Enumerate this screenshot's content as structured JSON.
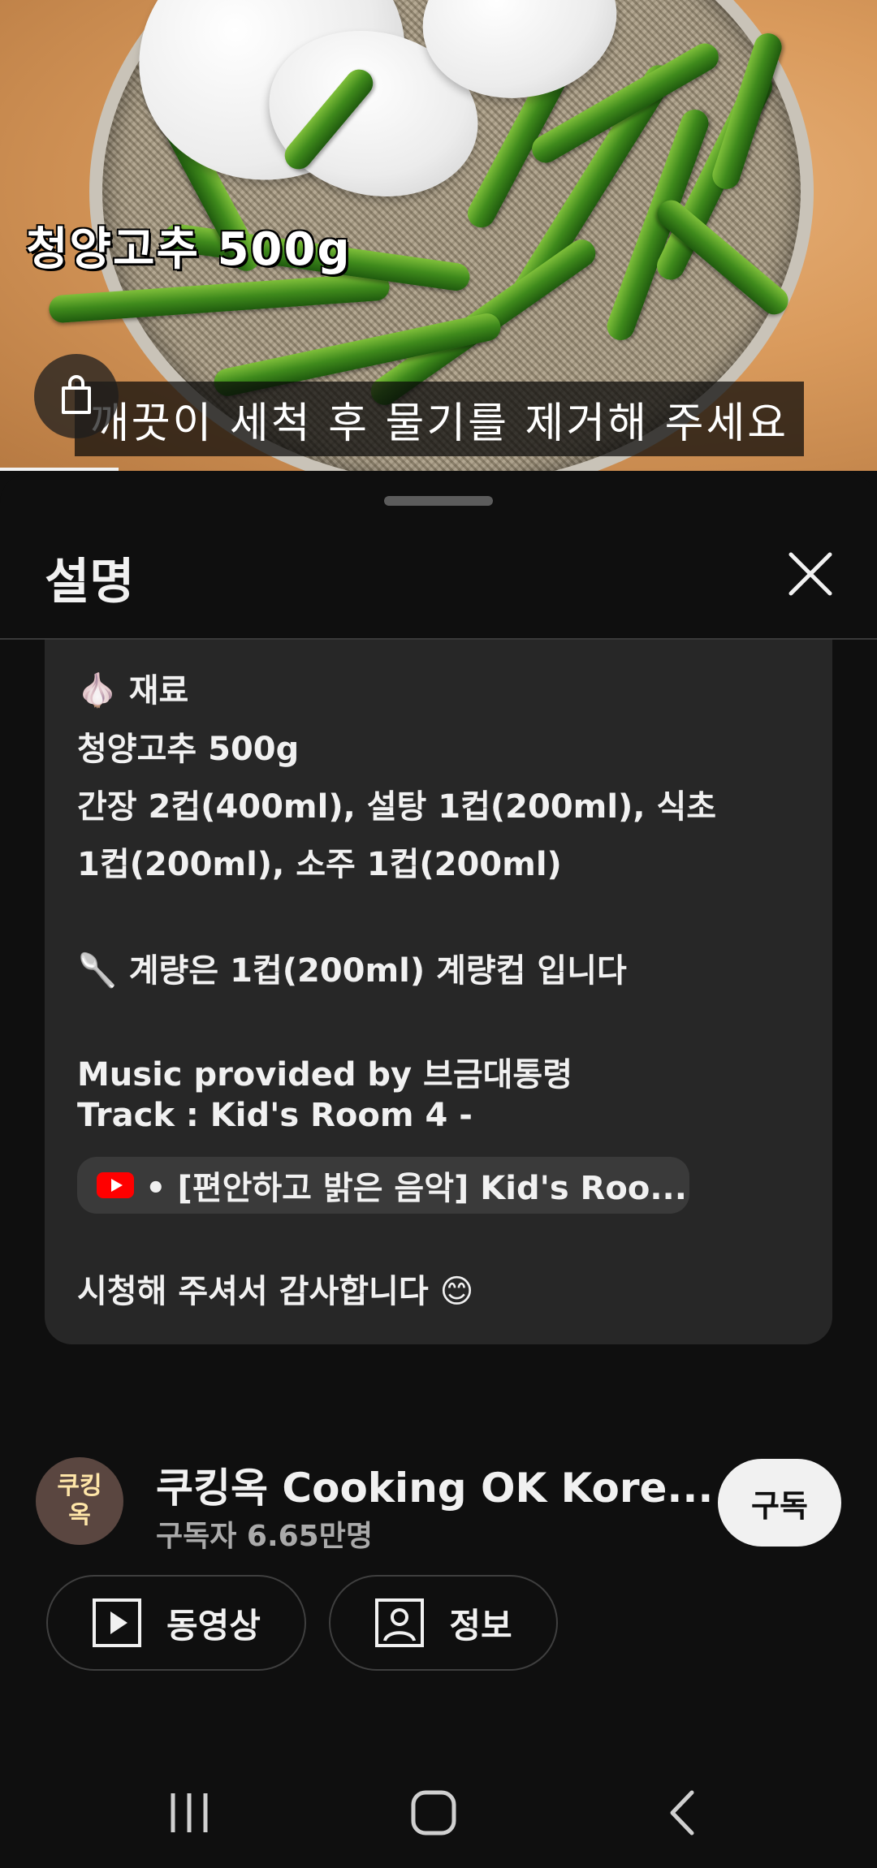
{
  "video": {
    "caption_title": "청양고추 500g",
    "subtitle": "깨끗이 세척 후 물기를 제거해 주세요",
    "shopping_icon": "shopping-bag-icon"
  },
  "panel": {
    "title": "설명",
    "close_icon": "close-icon"
  },
  "description": {
    "ingredients_heading": "재료",
    "ingredients_emoji": "🧄",
    "line_pepper": "청양고추 500g",
    "line_sauce_1": "간장 2컵(400ml), 설탕 1컵(200ml), 식초",
    "line_sauce_2": "1컵(200ml), 소주 1컵(200ml)",
    "measure_emoji": "🥄",
    "measure_note": "계량은 1컵(200ml) 계량컵 입니다",
    "music_line": "Music provided by 브금대통령",
    "track_line": "Track : Kid's Room 4 -",
    "link_text": "• [편안하고 밝은 음악] Kid's Roo...",
    "thanks": "시청해 주셔서 감사합니다",
    "thanks_emoji": "😊"
  },
  "channel": {
    "avatar_line1": "쿠킹",
    "avatar_line2": "옥",
    "name": "쿠킹옥 Cooking OK Kore...",
    "subscribers": "구독자 6.65만명",
    "subscribe_label": "구독",
    "videos_label": "동영상",
    "about_label": "정보"
  },
  "colors": {
    "background": "#0f0f0f",
    "card": "#272727",
    "chip": "#3a3a3a",
    "youtube_red": "#ff0000",
    "subscribe_bg": "#f1f1f1"
  }
}
